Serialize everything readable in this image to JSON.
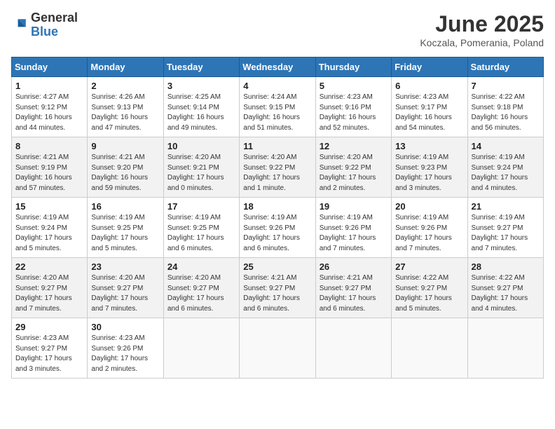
{
  "header": {
    "logo_line1": "General",
    "logo_line2": "Blue",
    "month_title": "June 2025",
    "location": "Koczala, Pomerania, Poland"
  },
  "weekdays": [
    "Sunday",
    "Monday",
    "Tuesday",
    "Wednesday",
    "Thursday",
    "Friday",
    "Saturday"
  ],
  "weeks": [
    [
      {
        "day": "1",
        "info": "Sunrise: 4:27 AM\nSunset: 9:12 PM\nDaylight: 16 hours\nand 44 minutes."
      },
      {
        "day": "2",
        "info": "Sunrise: 4:26 AM\nSunset: 9:13 PM\nDaylight: 16 hours\nand 47 minutes."
      },
      {
        "day": "3",
        "info": "Sunrise: 4:25 AM\nSunset: 9:14 PM\nDaylight: 16 hours\nand 49 minutes."
      },
      {
        "day": "4",
        "info": "Sunrise: 4:24 AM\nSunset: 9:15 PM\nDaylight: 16 hours\nand 51 minutes."
      },
      {
        "day": "5",
        "info": "Sunrise: 4:23 AM\nSunset: 9:16 PM\nDaylight: 16 hours\nand 52 minutes."
      },
      {
        "day": "6",
        "info": "Sunrise: 4:23 AM\nSunset: 9:17 PM\nDaylight: 16 hours\nand 54 minutes."
      },
      {
        "day": "7",
        "info": "Sunrise: 4:22 AM\nSunset: 9:18 PM\nDaylight: 16 hours\nand 56 minutes."
      }
    ],
    [
      {
        "day": "8",
        "info": "Sunrise: 4:21 AM\nSunset: 9:19 PM\nDaylight: 16 hours\nand 57 minutes."
      },
      {
        "day": "9",
        "info": "Sunrise: 4:21 AM\nSunset: 9:20 PM\nDaylight: 16 hours\nand 59 minutes."
      },
      {
        "day": "10",
        "info": "Sunrise: 4:20 AM\nSunset: 9:21 PM\nDaylight: 17 hours\nand 0 minutes."
      },
      {
        "day": "11",
        "info": "Sunrise: 4:20 AM\nSunset: 9:22 PM\nDaylight: 17 hours\nand 1 minute."
      },
      {
        "day": "12",
        "info": "Sunrise: 4:20 AM\nSunset: 9:22 PM\nDaylight: 17 hours\nand 2 minutes."
      },
      {
        "day": "13",
        "info": "Sunrise: 4:19 AM\nSunset: 9:23 PM\nDaylight: 17 hours\nand 3 minutes."
      },
      {
        "day": "14",
        "info": "Sunrise: 4:19 AM\nSunset: 9:24 PM\nDaylight: 17 hours\nand 4 minutes."
      }
    ],
    [
      {
        "day": "15",
        "info": "Sunrise: 4:19 AM\nSunset: 9:24 PM\nDaylight: 17 hours\nand 5 minutes."
      },
      {
        "day": "16",
        "info": "Sunrise: 4:19 AM\nSunset: 9:25 PM\nDaylight: 17 hours\nand 5 minutes."
      },
      {
        "day": "17",
        "info": "Sunrise: 4:19 AM\nSunset: 9:25 PM\nDaylight: 17 hours\nand 6 minutes."
      },
      {
        "day": "18",
        "info": "Sunrise: 4:19 AM\nSunset: 9:26 PM\nDaylight: 17 hours\nand 6 minutes."
      },
      {
        "day": "19",
        "info": "Sunrise: 4:19 AM\nSunset: 9:26 PM\nDaylight: 17 hours\nand 7 minutes."
      },
      {
        "day": "20",
        "info": "Sunrise: 4:19 AM\nSunset: 9:26 PM\nDaylight: 17 hours\nand 7 minutes."
      },
      {
        "day": "21",
        "info": "Sunrise: 4:19 AM\nSunset: 9:27 PM\nDaylight: 17 hours\nand 7 minutes."
      }
    ],
    [
      {
        "day": "22",
        "info": "Sunrise: 4:20 AM\nSunset: 9:27 PM\nDaylight: 17 hours\nand 7 minutes."
      },
      {
        "day": "23",
        "info": "Sunrise: 4:20 AM\nSunset: 9:27 PM\nDaylight: 17 hours\nand 7 minutes."
      },
      {
        "day": "24",
        "info": "Sunrise: 4:20 AM\nSunset: 9:27 PM\nDaylight: 17 hours\nand 6 minutes."
      },
      {
        "day": "25",
        "info": "Sunrise: 4:21 AM\nSunset: 9:27 PM\nDaylight: 17 hours\nand 6 minutes."
      },
      {
        "day": "26",
        "info": "Sunrise: 4:21 AM\nSunset: 9:27 PM\nDaylight: 17 hours\nand 6 minutes."
      },
      {
        "day": "27",
        "info": "Sunrise: 4:22 AM\nSunset: 9:27 PM\nDaylight: 17 hours\nand 5 minutes."
      },
      {
        "day": "28",
        "info": "Sunrise: 4:22 AM\nSunset: 9:27 PM\nDaylight: 17 hours\nand 4 minutes."
      }
    ],
    [
      {
        "day": "29",
        "info": "Sunrise: 4:23 AM\nSunset: 9:27 PM\nDaylight: 17 hours\nand 3 minutes."
      },
      {
        "day": "30",
        "info": "Sunrise: 4:23 AM\nSunset: 9:26 PM\nDaylight: 17 hours\nand 2 minutes."
      },
      {
        "day": "",
        "info": ""
      },
      {
        "day": "",
        "info": ""
      },
      {
        "day": "",
        "info": ""
      },
      {
        "day": "",
        "info": ""
      },
      {
        "day": "",
        "info": ""
      }
    ]
  ]
}
